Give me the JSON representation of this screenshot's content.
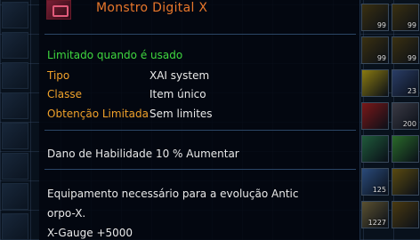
{
  "item": {
    "name": "Monstro Digital X",
    "icon": "digimon-card-icon"
  },
  "restriction": "Limitado quando é usado",
  "attributes": [
    {
      "label": "Tipo",
      "value": "XAI system"
    },
    {
      "label": "Classe",
      "value": "Item único"
    },
    {
      "label": "Obtenção Limitada",
      "value": "Sem limites"
    }
  ],
  "skill_bonus": "Dano de Habilidade 10 % Aumentar",
  "requirement": {
    "line1": "Equipamento necessário para a evolução Antic",
    "line2": "orpo-X.",
    "line3": "X-Gauge +5000"
  },
  "right_slots": [
    {
      "icon": "gold-wing-icon",
      "count": "99",
      "color": "#3a3010"
    },
    {
      "icon": "gold-wing-icon",
      "count": "99",
      "color": "#3a3010"
    },
    {
      "icon": "gold-wing-icon",
      "count": "99",
      "color": "#3a3010"
    },
    {
      "icon": "gold-wing-icon",
      "count": "99",
      "color": "#3a3010"
    },
    {
      "icon": "mystery-box-icon",
      "count": "",
      "color": "#8a7a10"
    },
    {
      "icon": "horn-icon",
      "count": "23",
      "color": "#2a3d66"
    },
    {
      "icon": "gift-box-icon",
      "count": "",
      "color": "#7a1818"
    },
    {
      "icon": "bag-icon",
      "count": "200",
      "color": "#3a3a44"
    },
    {
      "icon": "helmet-icon",
      "count": "",
      "color": "#1f5a3a"
    },
    {
      "icon": "green-item-icon",
      "count": "",
      "color": "#2a6a2a"
    },
    {
      "icon": "crystal-icon",
      "count": "125",
      "color": "#2a4a7a"
    },
    {
      "icon": "gold-chest-icon",
      "count": "",
      "color": "#5a4a10"
    },
    {
      "icon": "card-icon",
      "count": "1227",
      "color": "#5a5030"
    },
    {
      "icon": "gold-chest-icon",
      "count": "",
      "color": "#4a3a10"
    }
  ]
}
